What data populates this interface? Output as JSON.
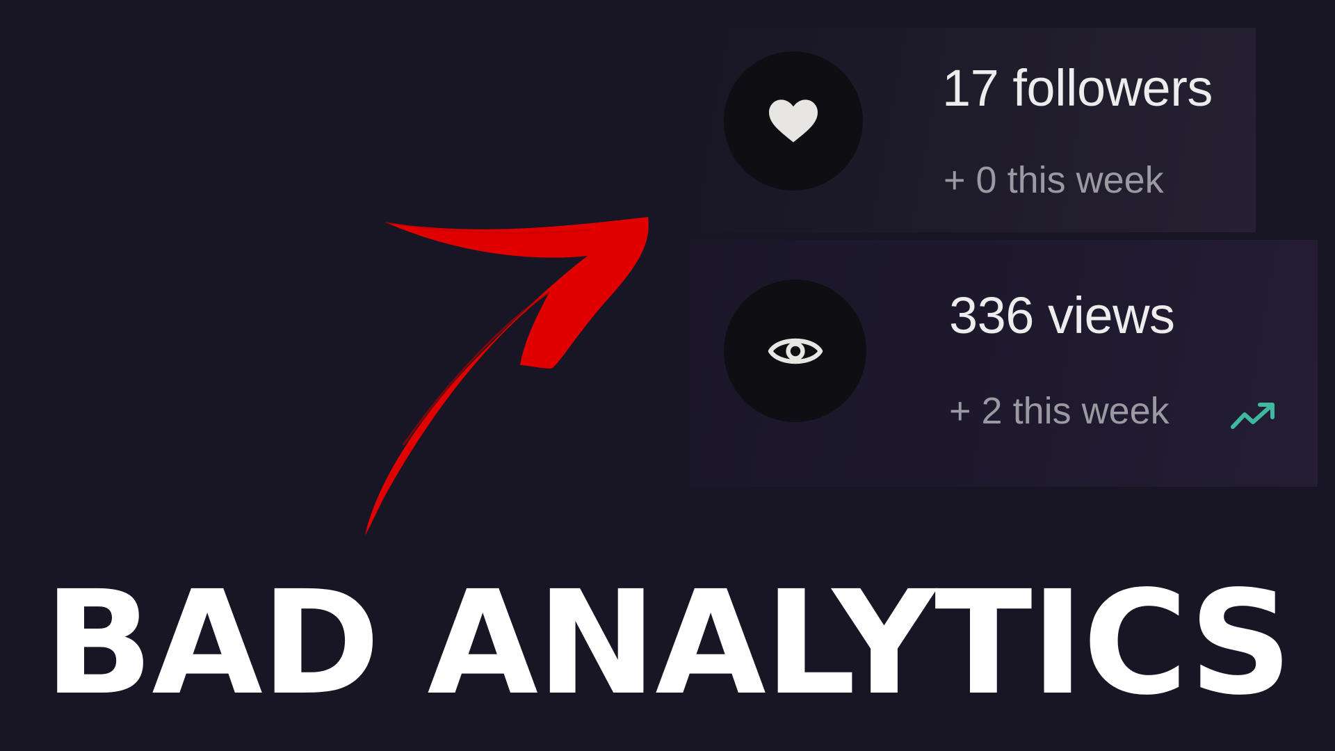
{
  "headline": "BAD ANALYTICS",
  "stats": {
    "followers": {
      "value": "17 followers",
      "change": "+ 0 this week",
      "icon": "heart-icon"
    },
    "views": {
      "value": "336 views",
      "change": "+ 2 this week",
      "icon": "eye-icon",
      "trend_icon": "trending-up-icon"
    }
  },
  "decorations": {
    "arrow_icon": "red-arrow-icon"
  },
  "colors": {
    "background": "#181624",
    "icon_circle": "#0f0f13",
    "value_text": "#ededed",
    "sub_text": "#9b9aa3",
    "trend": "#3fb8a0",
    "arrow": "#e00000",
    "headline": "#ffffff"
  }
}
